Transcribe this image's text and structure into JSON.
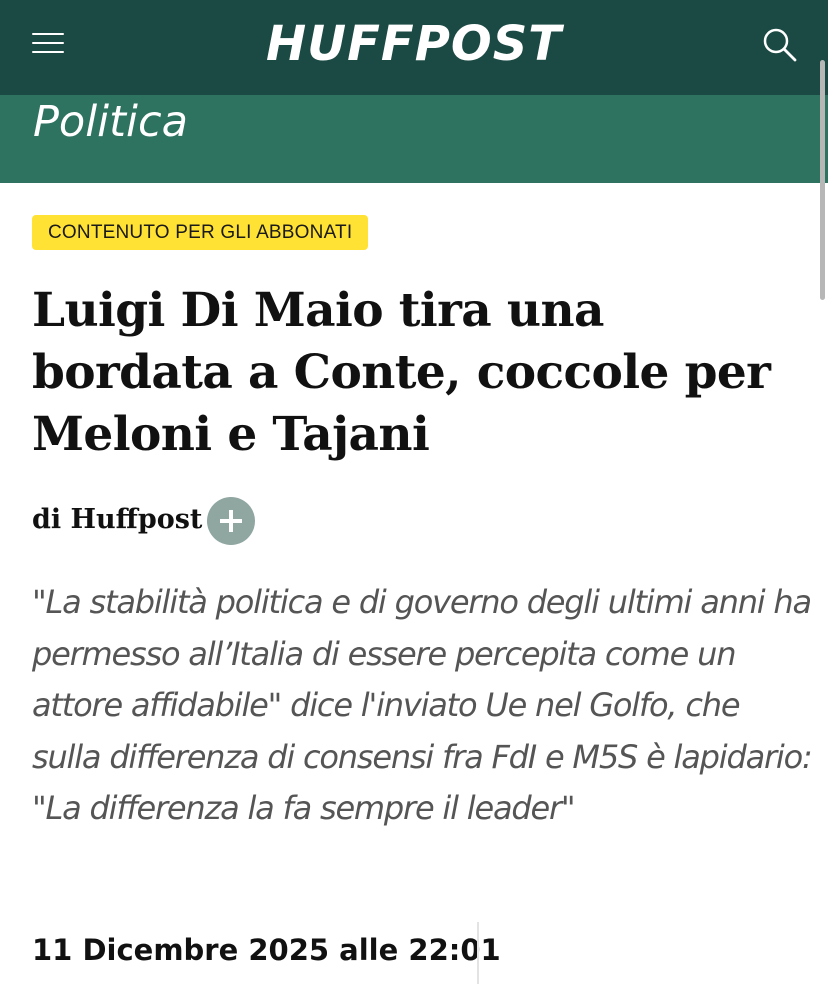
{
  "header": {
    "logo_text": "HUFFPOST",
    "menu_icon": "hamburger-menu-icon",
    "search_icon": "search-icon",
    "colors": {
      "topbar": "#1b4a44",
      "section_band": "#2e7260"
    }
  },
  "section": {
    "title": "Politica"
  },
  "article": {
    "badge": "CONTENUTO PER GLI ABBONATI",
    "badge_color": "#ffe234",
    "headline": "Luigi Di Maio tira una bordata a Conte, coccole per Meloni e Tajani",
    "author": "di Huffpost",
    "follow_icon": "plus-icon",
    "summary": "\"La stabilità politica e di governo degli ultimi anni ha permesso all’Italia di essere percepita come un attore affidabile\" dice l'inviato Ue nel Golfo, che sulla differenza di consensi fra FdI e M5S è lapidario: \"La differenza la fa sempre il leader\"",
    "date": "11 Dicembre 2025 alle 22:01"
  }
}
